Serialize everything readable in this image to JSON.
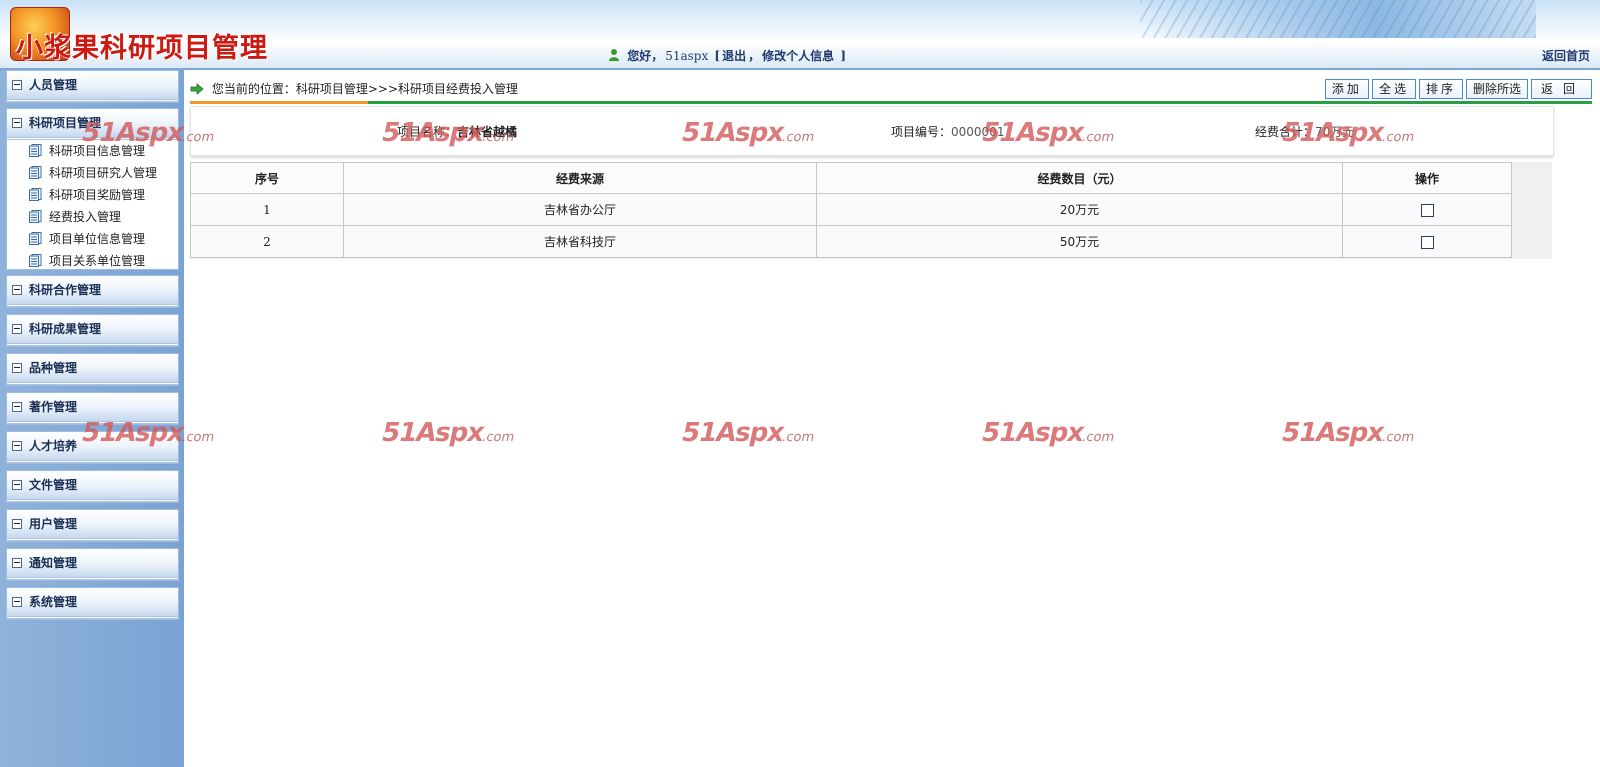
{
  "header": {
    "app_title": "小浆果科研项目管理",
    "greeting": "您好，",
    "username": "51aspx",
    "bracket_open": "[",
    "logout": "退出",
    "sep": "，",
    "edit_profile": "修改个人信息",
    "bracket_close": "]",
    "back_home": "返回首页"
  },
  "sidebar": {
    "groups": [
      {
        "label": "人员管理"
      },
      {
        "label": "科研项目管理",
        "items": [
          "科研项目信息管理",
          "科研项目研究人管理",
          "科研项目奖励管理",
          "经费投入管理",
          "项目单位信息管理",
          "项目关系单位管理"
        ]
      },
      {
        "label": "科研合作管理"
      },
      {
        "label": "科研成果管理"
      },
      {
        "label": "品种管理"
      },
      {
        "label": "著作管理"
      },
      {
        "label": "人才培养"
      },
      {
        "label": "文件管理"
      },
      {
        "label": "用户管理"
      },
      {
        "label": "通知管理"
      },
      {
        "label": "系统管理"
      }
    ]
  },
  "main": {
    "breadcrumb": "您当前的位置：科研项目管理>>>科研项目经费投入管理",
    "toolbar": {
      "add": "添加",
      "select_all": "全选",
      "sort": "排序",
      "delete_selected": "删除所选",
      "back": "返回"
    },
    "info": {
      "project_name_label": "项目名称：",
      "project_name": "吉林省越橘",
      "project_no_label": "项目编号：",
      "project_no": "0000001",
      "total_label": "经费合计：",
      "total_value": "70万元"
    },
    "table": {
      "headers": [
        "序号",
        "经费来源",
        "经费数目（元）",
        "操作"
      ],
      "rows": [
        {
          "no": "1",
          "source": "吉林省办公厅",
          "amount": "20万元"
        },
        {
          "no": "2",
          "source": "吉林省科技厅",
          "amount": "50万元"
        }
      ]
    }
  },
  "watermark": {
    "big": "51Aspx",
    "small": ".com"
  },
  "colors": {
    "accent_orange": "#f09a2d",
    "accent_green": "#23a244",
    "title_red": "#cc1a12",
    "sidebar_blue": "#7aa3d3"
  }
}
